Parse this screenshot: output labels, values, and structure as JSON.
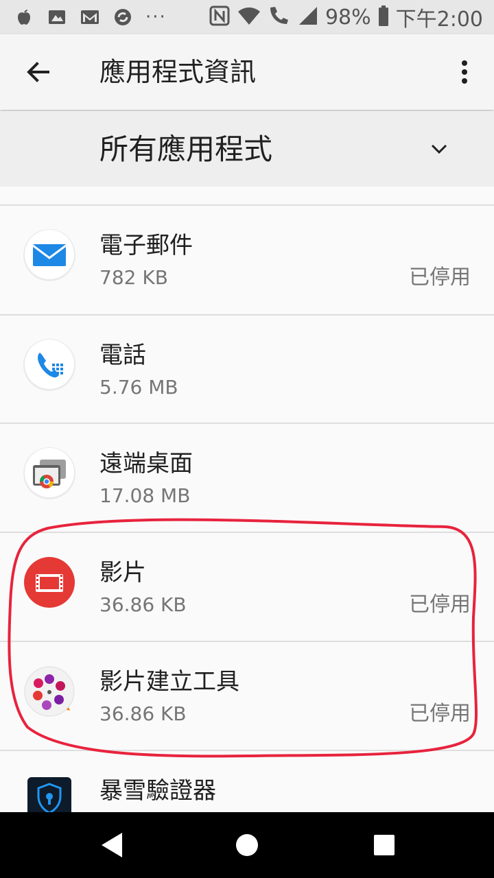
{
  "status_bar": {
    "battery_text": "98%",
    "time": "下午2:00",
    "overflow_dots": "···"
  },
  "app_bar": {
    "title": "應用程式資訊"
  },
  "filter": {
    "label": "所有應用程式"
  },
  "apps": [
    {
      "name": "電子郵件",
      "size": "782 KB",
      "status": "已停用",
      "icon": "email-icon"
    },
    {
      "name": "電話",
      "size": "5.76 MB",
      "status": "",
      "icon": "phone-icon"
    },
    {
      "name": "遠端桌面",
      "size": "17.08 MB",
      "status": "",
      "icon": "remote-desktop-icon"
    },
    {
      "name": "影片",
      "size": "36.86 KB",
      "status": "已停用",
      "icon": "video-icon"
    },
    {
      "name": "影片建立工具",
      "size": "36.86 KB",
      "status": "已停用",
      "icon": "movie-creator-icon"
    },
    {
      "name": "暴雪驗證器",
      "size": "",
      "status": "",
      "icon": "authenticator-icon"
    }
  ],
  "colors": {
    "annotation": "#e8233d",
    "email_blue": "#1e88e5",
    "video_red": "#e53935"
  }
}
